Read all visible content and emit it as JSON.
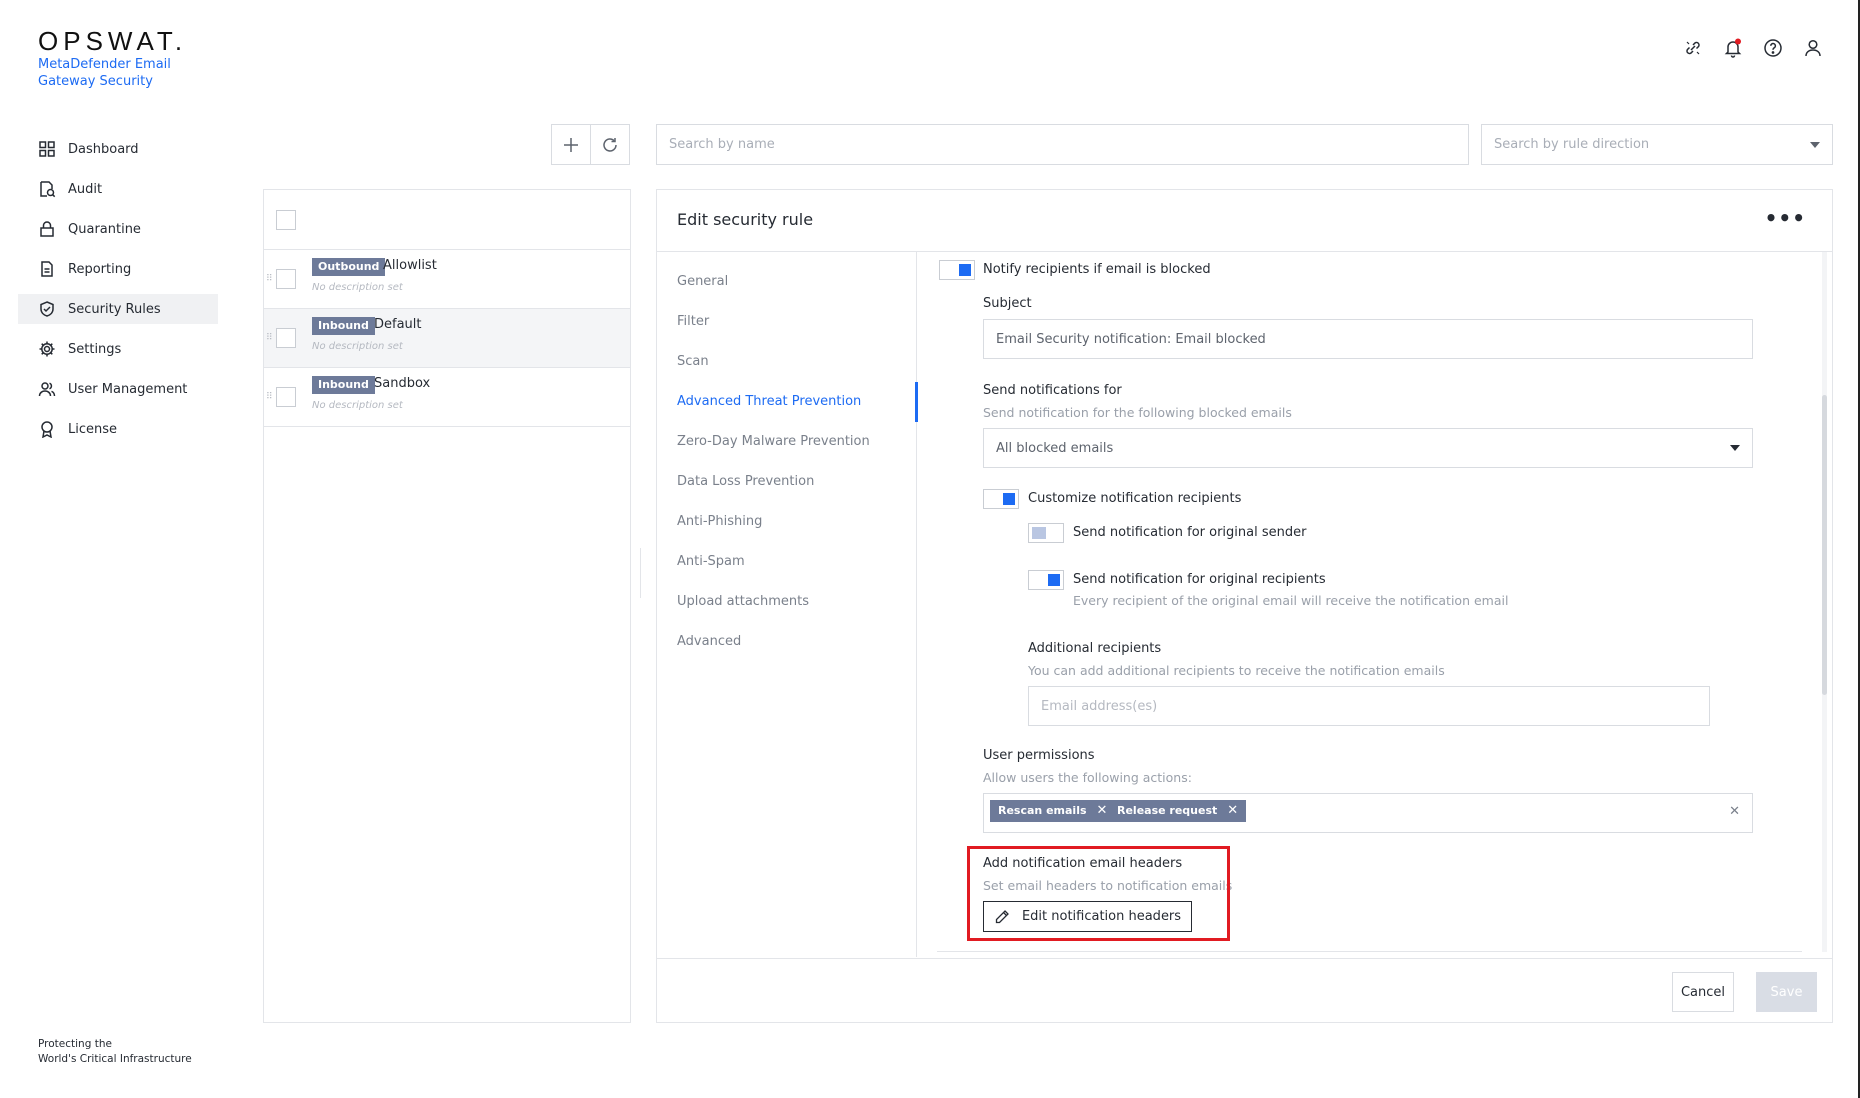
{
  "brand": {
    "logo": "OPSWAT.",
    "product": "MetaDefender Email Gateway Security",
    "footer_line1": "Protecting the",
    "footer_line2": "World's Critical Infrastructure"
  },
  "header_icons": [
    "link-icon",
    "bell-icon",
    "help-icon",
    "user-icon"
  ],
  "sidebar": {
    "items": [
      {
        "label": "Dashboard",
        "icon": "grid-icon"
      },
      {
        "label": "Audit",
        "icon": "audit-icon"
      },
      {
        "label": "Quarantine",
        "icon": "lock-icon"
      },
      {
        "label": "Reporting",
        "icon": "report-icon"
      },
      {
        "label": "Security Rules",
        "icon": "shield-check-icon"
      },
      {
        "label": "Settings",
        "icon": "gear-icon"
      },
      {
        "label": "User Management",
        "icon": "users-icon"
      },
      {
        "label": "License",
        "icon": "badge-icon"
      }
    ],
    "active": "Security Rules"
  },
  "toolbar": {
    "search_name_placeholder": "Search by name",
    "search_direction_placeholder": "Search by rule direction"
  },
  "rules": [
    {
      "direction": "Outbound",
      "name": "Allowlist",
      "description": "No description set"
    },
    {
      "direction": "Inbound",
      "name": "Default",
      "description": "No description set"
    },
    {
      "direction": "Inbound",
      "name": "Sandbox",
      "description": "No description set"
    }
  ],
  "edit": {
    "title": "Edit security rule",
    "menu": [
      "General",
      "Filter",
      "Scan",
      "Advanced Threat Prevention",
      "Zero-Day Malware Prevention",
      "Data Loss Prevention",
      "Anti-Phishing",
      "Anti-Spam",
      "Upload attachments",
      "Advanced"
    ],
    "active_menu": "Advanced Threat Prevention",
    "notify_label": "Notify recipients if email is blocked",
    "notify_on": true,
    "subject_label": "Subject",
    "subject_value": "Email Security notification: Email blocked",
    "send_for_label": "Send notifications for",
    "send_for_sub": "Send notification for the following blocked emails",
    "send_for_value": "All blocked emails",
    "customize_label": "Customize notification recipients",
    "customize_on": true,
    "orig_sender_label": "Send notification for original sender",
    "orig_sender_on": false,
    "orig_recipients_label": "Send notification for original recipients",
    "orig_recipients_on": true,
    "orig_recipients_sub": "Every recipient of the original email will receive the notification email",
    "additional_label": "Additional recipients",
    "additional_sub": "You can add additional recipients to receive the notification emails",
    "additional_placeholder": "Email address(es)",
    "permissions_label": "User permissions",
    "permissions_sub": "Allow users the following actions:",
    "permissions": [
      "Rescan emails",
      "Release request"
    ],
    "headers_label": "Add notification email headers",
    "headers_sub": "Set email headers to notification emails",
    "headers_button": "Edit notification headers",
    "cancel": "Cancel",
    "save": "Save"
  },
  "colors": {
    "accent": "#1d6bf3",
    "tag": "#6d7a99",
    "highlight": "#e11b22"
  }
}
